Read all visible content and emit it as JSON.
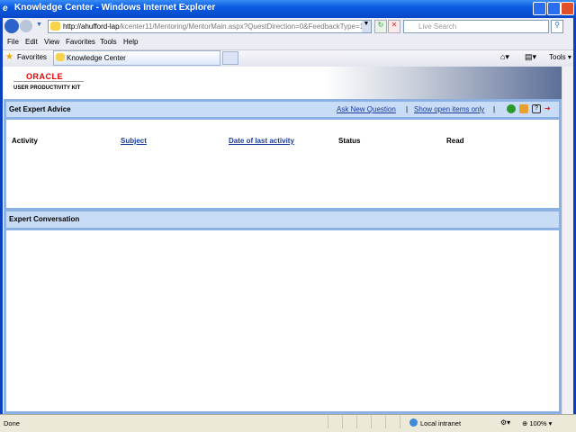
{
  "window": {
    "title": "Knowledge Center - Windows Internet Explorer"
  },
  "browser": {
    "url_host": "http://ahufford-lap",
    "url_path": "/kcenter11/Mentoring/MentorMain.aspx?QuestDirection=0&FeedbackType=1",
    "search_placeholder": "Live Search",
    "menu": [
      "File",
      "Edit",
      "View",
      "Favorites",
      "Tools",
      "Help"
    ],
    "favorites_label": "Favorites",
    "tab_label": "Knowledge Center",
    "tools_label": "Tools"
  },
  "page": {
    "logo_brand": "ORACLE",
    "logo_product": "USER PRODUCTIVITY KIT",
    "advice": {
      "title": "Get Expert Advice",
      "ask_link": "Ask New Question",
      "sep": "|",
      "open_link": "Show open items only",
      "columns": [
        "Activity",
        "Subject",
        "Date of last activity",
        "Status",
        "Read"
      ]
    },
    "conversation": {
      "title": "Expert Conversation"
    }
  },
  "status": {
    "text": "Done",
    "zone": "Local intranet",
    "zoom": "100%"
  }
}
